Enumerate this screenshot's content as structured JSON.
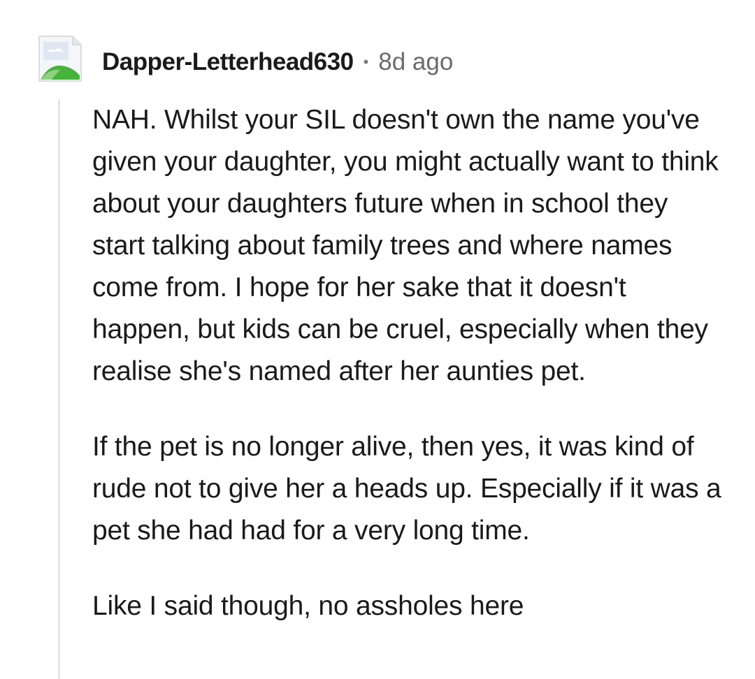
{
  "comment": {
    "author": "Dapper-Letterhead630",
    "separator": "•",
    "timestamp": "8d ago",
    "avatar_icon": "image-placeholder-icon",
    "paragraphs": [
      "NAH. Whilst your SIL doesn't own the name you've given your daughter, you might actually want to think about your daughters future when in school they start talking about family trees and where names come from. I hope for her sake that it doesn't happen, but kids can be cruel, especially when they realise she's named after her aunties pet.",
      "If the pet is no longer alive, then yes, it was kind of rude not to give her a heads up. Especially if it was a pet she had had for a very long time.",
      "Like I said though, no assholes here"
    ]
  },
  "colors": {
    "text": "#1a1a1b",
    "meta": "#6b6b6b",
    "thread_line": "#e6e6e6",
    "avatar_green": "#46b33a"
  }
}
